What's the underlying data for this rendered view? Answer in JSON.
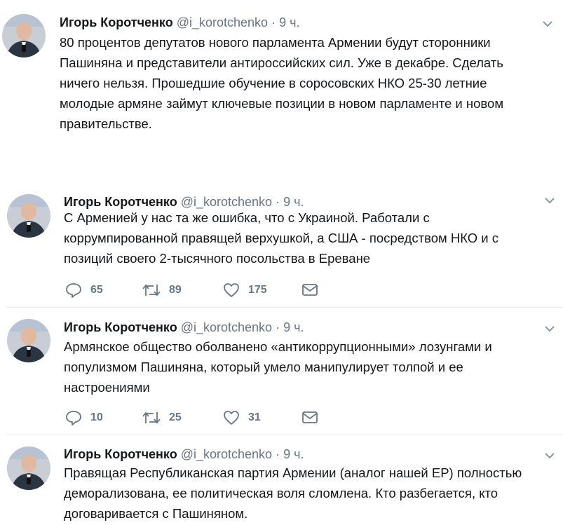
{
  "colors": {
    "text": "#14171a",
    "secondary": "#657786",
    "divider": "#e6ecf0"
  },
  "tweets": [
    {
      "name": "Игорь Коротченко",
      "handle": "@i_korotchenko",
      "dot": "·",
      "time": "9 ч.",
      "text": "80 процентов депутатов нового парламента Армении будут сторонники\nПашиняна и представители антироссийских сил. Уже в декабре. Сделать\nничего нельзя. Прошедшие обучение в соросовских НКО 25-30 летние\nмолодые армяне займут ключевые позиции в новом парламенте и новом\nправительстве."
    },
    {
      "name": "Игорь Коротченко",
      "handle": "@i_korotchenko",
      "dot": "·",
      "time": "9 ч.",
      "text": "С Арменией у нас та же ошибка, что с Украиной. Работали с\nкоррумпированной правящей верхушкой, а США - посредством НКО и с\nпозиций своего 2-тысячного посольства в Ереване",
      "replies": "65",
      "retweets": "89",
      "likes": "175"
    },
    {
      "name": "Игорь Коротченко",
      "handle": "@i_korotchenko",
      "dot": "·",
      "time": "9 ч.",
      "text": "Армянское общество оболванено «антикоррупционными» лозунгами и\nпопулизмом Пашиняна, который умело манипулирует толпой и ее\nнастроениями",
      "replies": "10",
      "retweets": "25",
      "likes": "31"
    },
    {
      "name": "Игорь Коротченко",
      "handle": "@i_korotchenko",
      "dot": "·",
      "time": "9 ч.",
      "text": "Правящая Республиканская партия Армении (аналог нашей ЕР) полностью\nдеморализована, ее политическая воля сломлена. Кто разбегается, кто\nдоговаривается с Пашиняном."
    }
  ]
}
